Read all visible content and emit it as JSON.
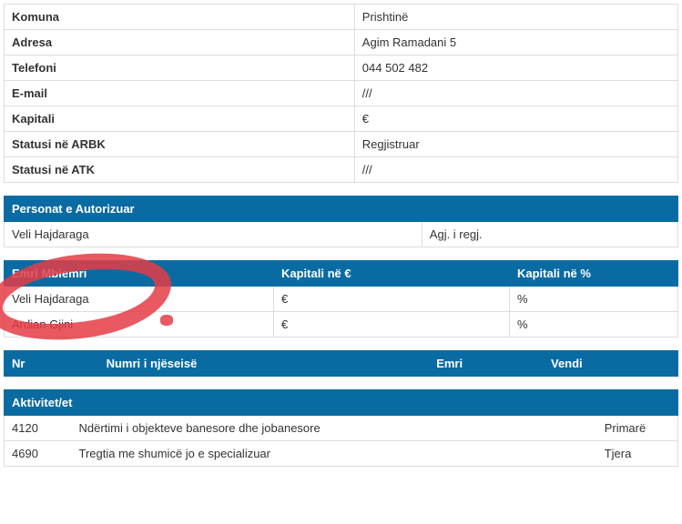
{
  "info": {
    "rows": [
      {
        "label": "Komuna",
        "value": "Prishtinë"
      },
      {
        "label": "Adresa",
        "value": "Agim Ramadani 5"
      },
      {
        "label": "Telefoni",
        "value": "044 502 482"
      },
      {
        "label": "E-mail",
        "value": "///"
      },
      {
        "label": "Kapitali",
        "value": "€"
      },
      {
        "label": "Statusi në ARBK",
        "value": "Regjistruar"
      },
      {
        "label": "Statusi në ATK",
        "value": "///"
      }
    ]
  },
  "authorized": {
    "header": "Personat e Autorizuar",
    "name": "Veli Hajdaraga",
    "role": "Agj. i regj."
  },
  "owners": {
    "headers": {
      "name": "Emri Mbiemri",
      "capital_eur": "Kapitali në €",
      "capital_pct": "Kapitali në %"
    },
    "rows": [
      {
        "name": "Veli Hajdaraga",
        "capital_eur": "€",
        "capital_pct": "%"
      },
      {
        "name": "Ardian Gjini",
        "capital_eur": "€",
        "capital_pct": "%"
      }
    ]
  },
  "units": {
    "headers": {
      "nr": "Nr",
      "unit_number": "Numri i njëseisë",
      "name": "Emri",
      "place": "Vendi"
    }
  },
  "activities": {
    "header": "Aktivitet/et",
    "rows": [
      {
        "code": "4120",
        "desc": "Ndërtimi i objekteve banesore dhe jobanesore",
        "type": "Primarë"
      },
      {
        "code": "4690",
        "desc": "Tregtia me shumicë jo e specializuar",
        "type": "Tjera"
      }
    ]
  }
}
